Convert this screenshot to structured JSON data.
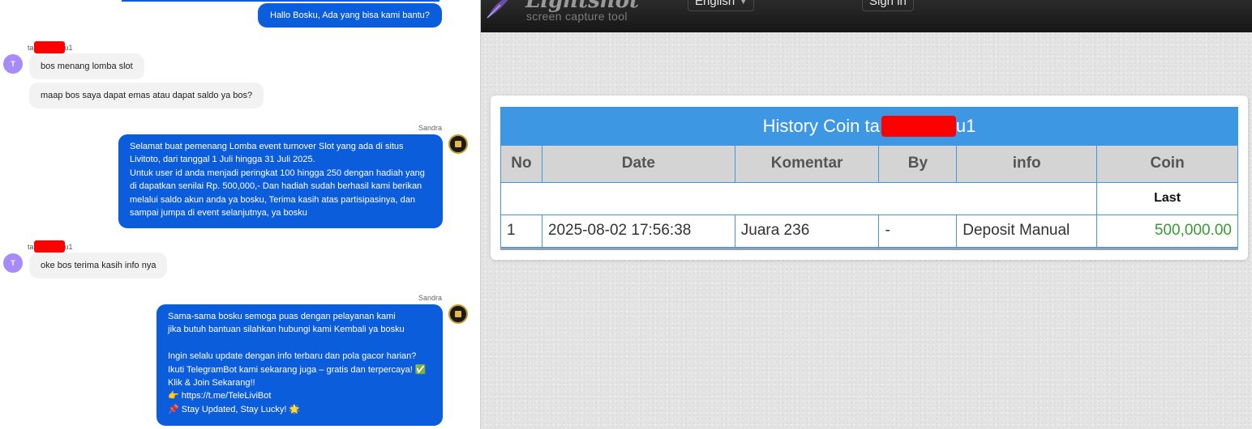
{
  "chat": {
    "greeting": "Hallo Bosku, Ada yang bisa kami bantu?",
    "user_name_prefix": "ta",
    "user_name_suffix": "u1",
    "user_avatar_letter": "T",
    "user_messages_1": [
      "bos menang lomba slot",
      "maap bos saya dapat emas atau dapat saldo ya bos?"
    ],
    "agent_name": "Sandra",
    "agent_message_1": "Selamat buat pemenang Lomba event turnover Slot yang ada di situs\nLivitoto, dari tanggal 1 Juli hingga 31 Juli 2025.\nUntuk user id anda menjadi peringkat 100 hingga 250 dengan hadiah yang\ndi dapatkan senilai Rp. 500,000,- Dan hadiah sudah berhasil kami berikan\nmelalui saldo akun anda ya bosku, Terima kasih atas partisipasinya, dan\nsampai jumpa di event selanjutnya, ya bosku",
    "user_message_2": "oke bos terima kasih info nya",
    "agent_message_2": "Sama-sama bosku semoga puas dengan pelayanan kami\njika butuh bantuan silahkan hubungi kami Kembali ya bosku\n\nIngin selalu update dengan info terbaru dan pola gacor harian?\nIkuti TelegramBot kami sekarang juga – gratis dan terpercaya! ✅\nKlik & Join Sekarang!!\n👉 https://t.me/TeleLiviBot\n📌 Stay Updated, Stay Lucky! 🌟"
  },
  "lightshot": {
    "logo": "Lightshot",
    "tagline": "screen capture tool",
    "language": "English",
    "sign_in": "Sign in"
  },
  "history": {
    "title_prefix": "History Coin ta",
    "title_suffix": "u1",
    "columns": [
      "No",
      "Date",
      "Komentar",
      "By",
      "info",
      "Coin"
    ],
    "last_label": "Last",
    "rows": [
      {
        "no": "1",
        "date": "2025-08-02 17:56:38",
        "komentar": "Juara 236",
        "by": "-",
        "info": "Deposit Manual",
        "coin": "500,000.00"
      }
    ]
  },
  "colors": {
    "chat_blue": "#0b5ddc",
    "header_blue": "#3d97e2",
    "coin_green": "#3a9a35",
    "redaction": "#ff0000"
  }
}
